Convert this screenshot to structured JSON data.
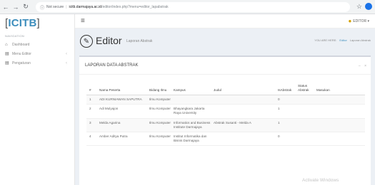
{
  "browser": {
    "not_secure": "Not secure",
    "url_domain": "icitb.darmajaya.ac.id",
    "url_path": "/editor/index.php?menu=editor_lapabstrak"
  },
  "sidebar": {
    "brand": "ICITB",
    "nav_header": "NAVIGATION",
    "items": [
      {
        "label": "Dashboard",
        "icon": "home-icon"
      },
      {
        "label": "Menu Editor",
        "icon": "file-icon"
      },
      {
        "label": "Pengaturan",
        "icon": "file-icon"
      }
    ]
  },
  "topbar": {
    "user": "EDITOR"
  },
  "header": {
    "title": "Editor",
    "subtitle": "Laporan Abstrak",
    "breadcrumb": [
      "YOU ARE HERE:",
      "Editor",
      "Laporan Abstrak"
    ]
  },
  "box": {
    "title": "LAPORAN DATA ABSTRAK",
    "tools": [
      "–",
      "×"
    ]
  },
  "table": {
    "columns": [
      "#",
      "Nama Peserta",
      "Bidang Ilmu",
      "Kampus",
      "Judul",
      "IsAbstrak",
      "Status Abstrak",
      "Masukan"
    ],
    "rows": [
      {
        "no": "1",
        "nama": "ADI KURNIAWAN SAPUTRA",
        "bidang": "Ilmu Komputer",
        "kampus": "",
        "judul": "",
        "isabstrak": "0",
        "status": "",
        "masukan": ""
      },
      {
        "no": "2",
        "nama": "Adi Mulyajon",
        "bidang": "Ilmu Komputer",
        "kampus": "Bhayangkara Jakarta Raya University",
        "judul": "",
        "isabstrak": "1",
        "status": "",
        "masukan": ""
      },
      {
        "no": "3",
        "nama": "Melda Agarina",
        "bidang": "Ilmu Komputer",
        "kampus": "Informatics and Business Institute Darmajaya",
        "judul": "Abstrak Susanti - Melda A",
        "isabstrak": "1",
        "status": "",
        "masukan": ""
      },
      {
        "no": "4",
        "nama": "Amber Aditya Putra",
        "bidang": "Ilmu Komputer",
        "kampus": "Institut Informatika dan Bisnis Darmajaya",
        "judul": "",
        "isabstrak": "0",
        "status": "",
        "masukan": ""
      }
    ]
  },
  "watermark": "Activate Windows"
}
